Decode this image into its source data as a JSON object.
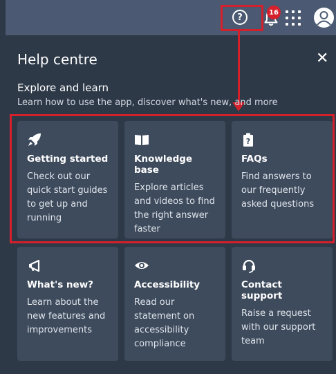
{
  "topbar": {
    "help_glyph": "?",
    "notification_count": "16",
    "accent_color": "#d5202b"
  },
  "panel": {
    "title": "Help centre",
    "close_glyph": "✕",
    "section_title": "Explore and learn",
    "section_description": "Learn how to use the app, discover what's new, and more"
  },
  "cards": [
    {
      "icon": "rocket-icon",
      "title": "Getting started",
      "text": "Check out our quick start guides to get up and running"
    },
    {
      "icon": "book-icon",
      "title": "Knowledge base",
      "text": "Explore articles and videos to find the right answer faster"
    },
    {
      "icon": "faq-icon",
      "title": "FAQs",
      "text": "Find answers to our frequently asked questions"
    },
    {
      "icon": "megaphone-icon",
      "title": "What's new?",
      "text": "Learn about the new features and improvements"
    },
    {
      "icon": "eye-icon",
      "title": "Accessibility",
      "text": "Read our statement on accessibility compliance"
    },
    {
      "icon": "headset-icon",
      "title": "Contact support",
      "text": "Raise a request with our support team"
    }
  ]
}
